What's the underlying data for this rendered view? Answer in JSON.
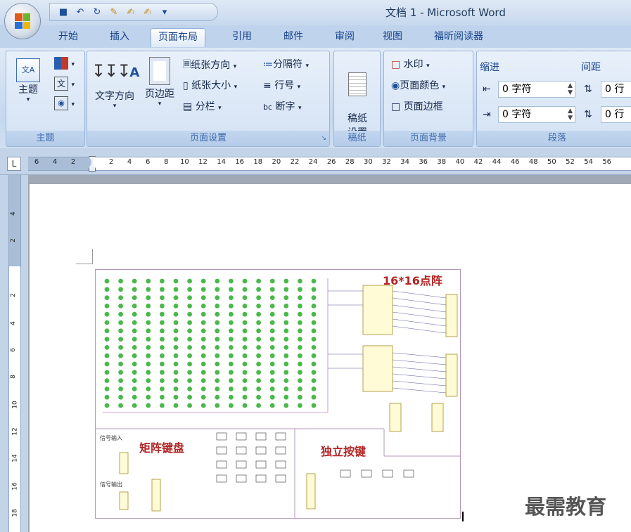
{
  "titlebar": {
    "title": "文档 1 - Microsoft Word"
  },
  "tabs": [
    "开始",
    "插入",
    "页面布局",
    "引用",
    "邮件",
    "审阅",
    "视图",
    "福昕阅读器"
  ],
  "active_tab": "页面布局",
  "groups": {
    "theme": {
      "label": "主题",
      "theme_btn": "主题"
    },
    "page_setup": {
      "label": "页面设置",
      "text_direction": "文字方向",
      "margins": "页边距",
      "orientation": "纸张方向",
      "size": "纸张大小",
      "columns": "分栏",
      "breaks": "分隔符",
      "line_numbers": "行号",
      "hyphenation": "断字"
    },
    "manuscript": {
      "label": "稿纸",
      "button": "稿纸\n设置"
    },
    "page_background": {
      "label": "页面背景",
      "watermark": "水印",
      "page_color": "页面颜色",
      "page_borders": "页面边框"
    },
    "paragraph": {
      "label": "段落",
      "indent_label": "缩进",
      "spacing_label": "间距",
      "indent_left": "0 字符",
      "indent_right": "0 字符",
      "spacing_before": "0 行",
      "spacing_after": "0 行"
    }
  },
  "ruler": {
    "tab_selector": "L",
    "numbers": [
      "6",
      "4",
      "2",
      "2",
      "4",
      "6",
      "8",
      "10",
      "12",
      "14",
      "16",
      "18",
      "20",
      "22",
      "24",
      "26",
      "28",
      "30",
      "32",
      "34",
      "36",
      "38",
      "40",
      "42",
      "44",
      "46",
      "48",
      "50",
      "52",
      "54",
      "56"
    ]
  },
  "vruler": {
    "numbers": [
      "4",
      "2",
      "2",
      "4",
      "6",
      "8",
      "10",
      "12",
      "14",
      "16",
      "18"
    ]
  },
  "figure": {
    "title_matrix": "16*16点阵",
    "title_keypad": "矩阵键盘",
    "title_buttons": "独立按键",
    "label_input": "信号输入",
    "label_output": "信号输出"
  },
  "watermark": "最需教育",
  "colors": {
    "accent": "#15428b",
    "led": "#4ab84a",
    "figure_title": "#b22424"
  }
}
